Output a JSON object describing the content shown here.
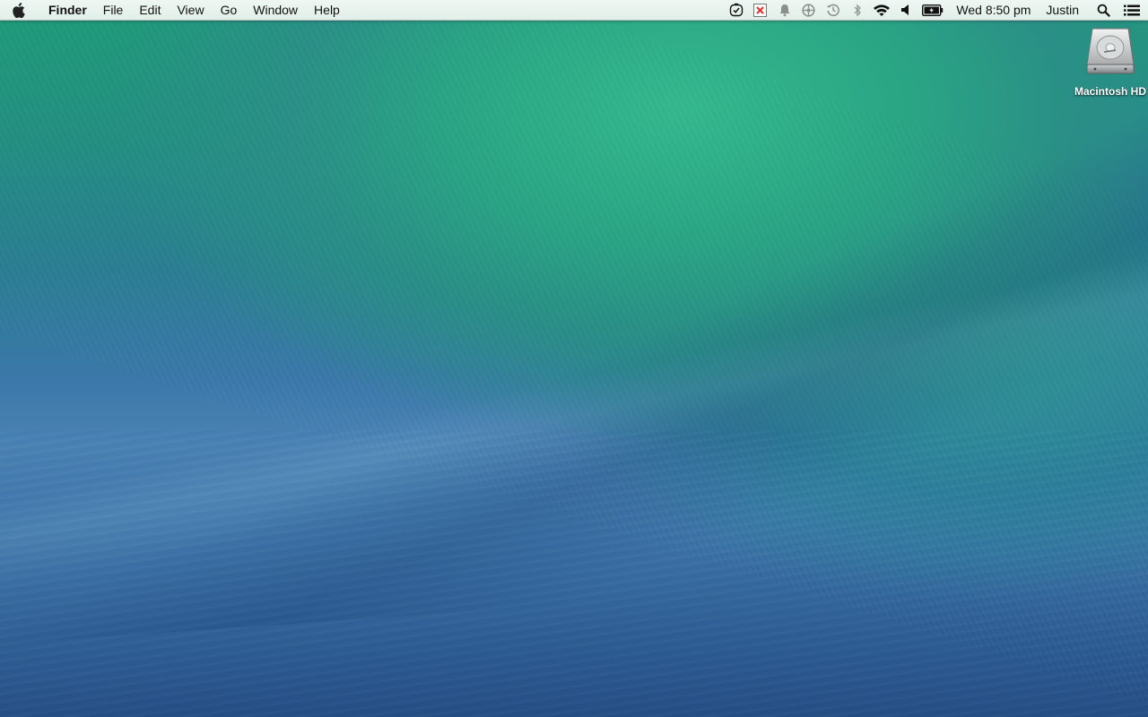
{
  "menubar": {
    "apple_menu_icon": "apple-icon",
    "app_name": "Finder",
    "menus": [
      "File",
      "Edit",
      "View",
      "Go",
      "Window",
      "Help"
    ],
    "status_icons": [
      "time-tracker-icon",
      "close-app-icon",
      "notification-bell-icon",
      "sync-icon",
      "time-machine-icon",
      "bluetooth-icon",
      "wifi-icon",
      "volume-icon",
      "battery-icon"
    ],
    "clock": "Wed 8:50 pm",
    "user": "Justin",
    "spotlight_icon": "search-icon",
    "notification_center_icon": "list-icon"
  },
  "desktop": {
    "icons": [
      {
        "label": "Macintosh HD",
        "icon": "hard-drive-icon"
      }
    ]
  },
  "colors": {
    "menubar_bg": "#e8f3ee",
    "wave_green": "#2aa584",
    "wave_blue": "#3a78a8",
    "close_red": "#d9322a"
  }
}
